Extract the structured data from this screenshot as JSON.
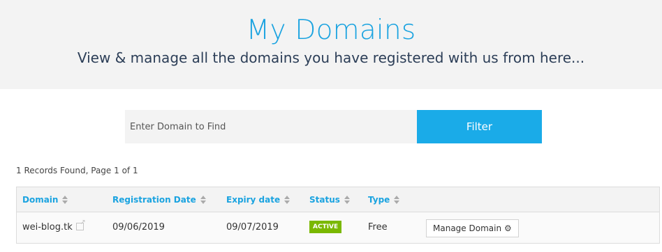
{
  "header": {
    "title": "My Domains",
    "subtitle": "View & manage all the domains you have registered with us from here..."
  },
  "search": {
    "placeholder": "Enter Domain to Find",
    "value": "",
    "filter_label": "Filter"
  },
  "records_text": "1 Records Found, Page 1 of 1",
  "table": {
    "columns": [
      "Domain",
      "Registration Date",
      "Expiry date",
      "Status",
      "Type"
    ],
    "rows": [
      {
        "domain": "wei-blog.tk",
        "registration_date": "09/06/2019",
        "expiry_date": "09/07/2019",
        "status": "ACTIVE",
        "type": "Free",
        "action_label": "Manage Domain"
      }
    ]
  },
  "icons": {
    "sort": "sort-icon",
    "external": "external-link-icon",
    "gear": "gear-icon"
  },
  "colors": {
    "accent": "#1aa3e0",
    "filter_button": "#1aabe8",
    "status_active": "#7ab800",
    "heading_sub": "#2c3e57"
  }
}
